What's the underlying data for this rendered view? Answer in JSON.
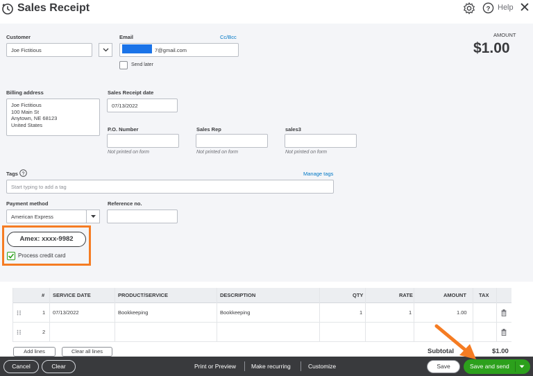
{
  "header": {
    "title": "Sales Receipt",
    "help_label": "Help",
    "close_glyph": "✕"
  },
  "form": {
    "customer_label": "Customer",
    "customer_value": "Joe Fictitious",
    "email_label": "Email",
    "email_value": "7@gmail.com",
    "ccbcc_label": "Cc/Bcc",
    "send_later_label": "Send later",
    "amount_label": "AMOUNT",
    "amount_value": "$1.00",
    "billing_label": "Billing address",
    "billing_lines": [
      "Joe Fictitious",
      "100 Main St",
      "Anytown, NE  68123",
      "United States"
    ],
    "date_label": "Sales Receipt date",
    "date_value": "07/13/2022",
    "po_label": "P.O. Number",
    "salesrep_label": "Sales Rep",
    "sales3_label": "sales3",
    "not_printed": "Not printed on form",
    "tags_label": "Tags",
    "manage_tags_label": "Manage tags",
    "tags_placeholder": "Start typing to add a tag",
    "payment_label": "Payment method",
    "payment_value": "American Express",
    "reference_label": "Reference no.",
    "card_label": "Amex: xxxx-9982",
    "process_card_label": "Process credit card",
    "process_card_checked": true
  },
  "table": {
    "columns": [
      "#",
      "SERVICE DATE",
      "PRODUCT/SERVICE",
      "DESCRIPTION",
      "QTY",
      "RATE",
      "AMOUNT",
      "TAX"
    ],
    "rows": [
      {
        "num": "1",
        "date": "07/13/2022",
        "product": "Bookkeeping",
        "description": "Bookkeeping",
        "qty": "1",
        "rate": "1",
        "amount": "1.00"
      },
      {
        "num": "2",
        "date": "",
        "product": "",
        "description": "",
        "qty": "",
        "rate": "",
        "amount": ""
      }
    ],
    "add_lines_label": "Add lines",
    "clear_lines_label": "Clear all lines",
    "subtotal_label": "Subtotal",
    "subtotal_value": "$1.00"
  },
  "footer": {
    "cancel_label": "Cancel",
    "clear_label": "Clear",
    "print_label": "Print or Preview",
    "recurring_label": "Make recurring",
    "customize_label": "Customize",
    "save_label": "Save",
    "save_send_label": "Save and send"
  },
  "colors": {
    "accent_green": "#2ca01c",
    "highlight_orange": "#f57c23",
    "link_blue": "#0077c5",
    "footer_bg": "#393a3d"
  }
}
